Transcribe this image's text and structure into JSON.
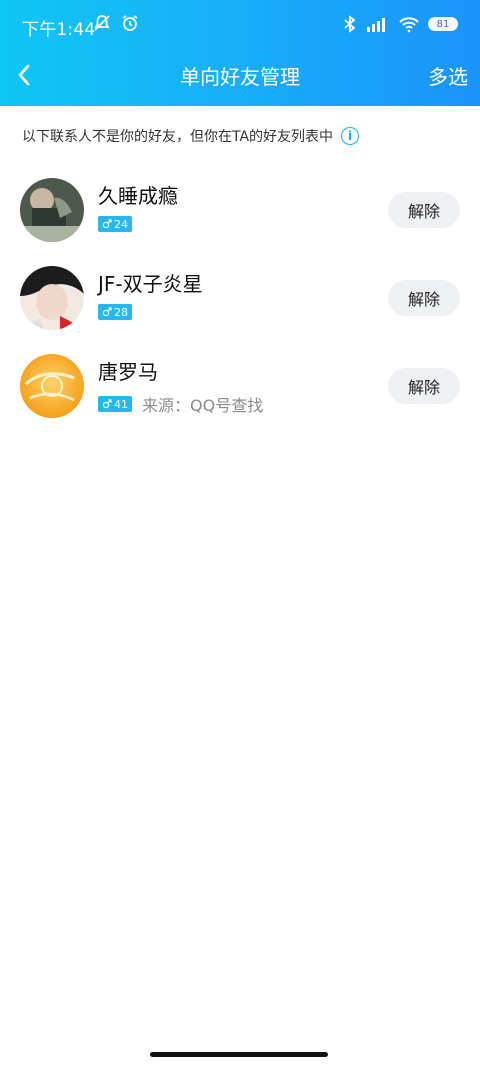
{
  "status": {
    "time": "下午1:44",
    "battery": "81"
  },
  "nav": {
    "title": "单向好友管理",
    "multi_select": "多选"
  },
  "hint": {
    "text": "以下联系人不是你的好友，但你在TA的好友列表中"
  },
  "contacts": [
    {
      "name": "久睡成瘾",
      "age": "24",
      "source": "",
      "action": "解除"
    },
    {
      "name": "JF-双子炎星",
      "age": "28",
      "source": "",
      "action": "解除"
    },
    {
      "name": "唐罗马",
      "age": "41",
      "source": "来源：QQ号查找",
      "action": "解除"
    }
  ],
  "icons": {
    "back": "chevron-left-icon",
    "info": "info-icon",
    "male": "male-icon"
  },
  "colors": {
    "header_gradient_start": "#10c6f5",
    "header_gradient_end": "#1a93fb",
    "badge": "#27b7ef",
    "button_bg": "#eef0f3"
  }
}
